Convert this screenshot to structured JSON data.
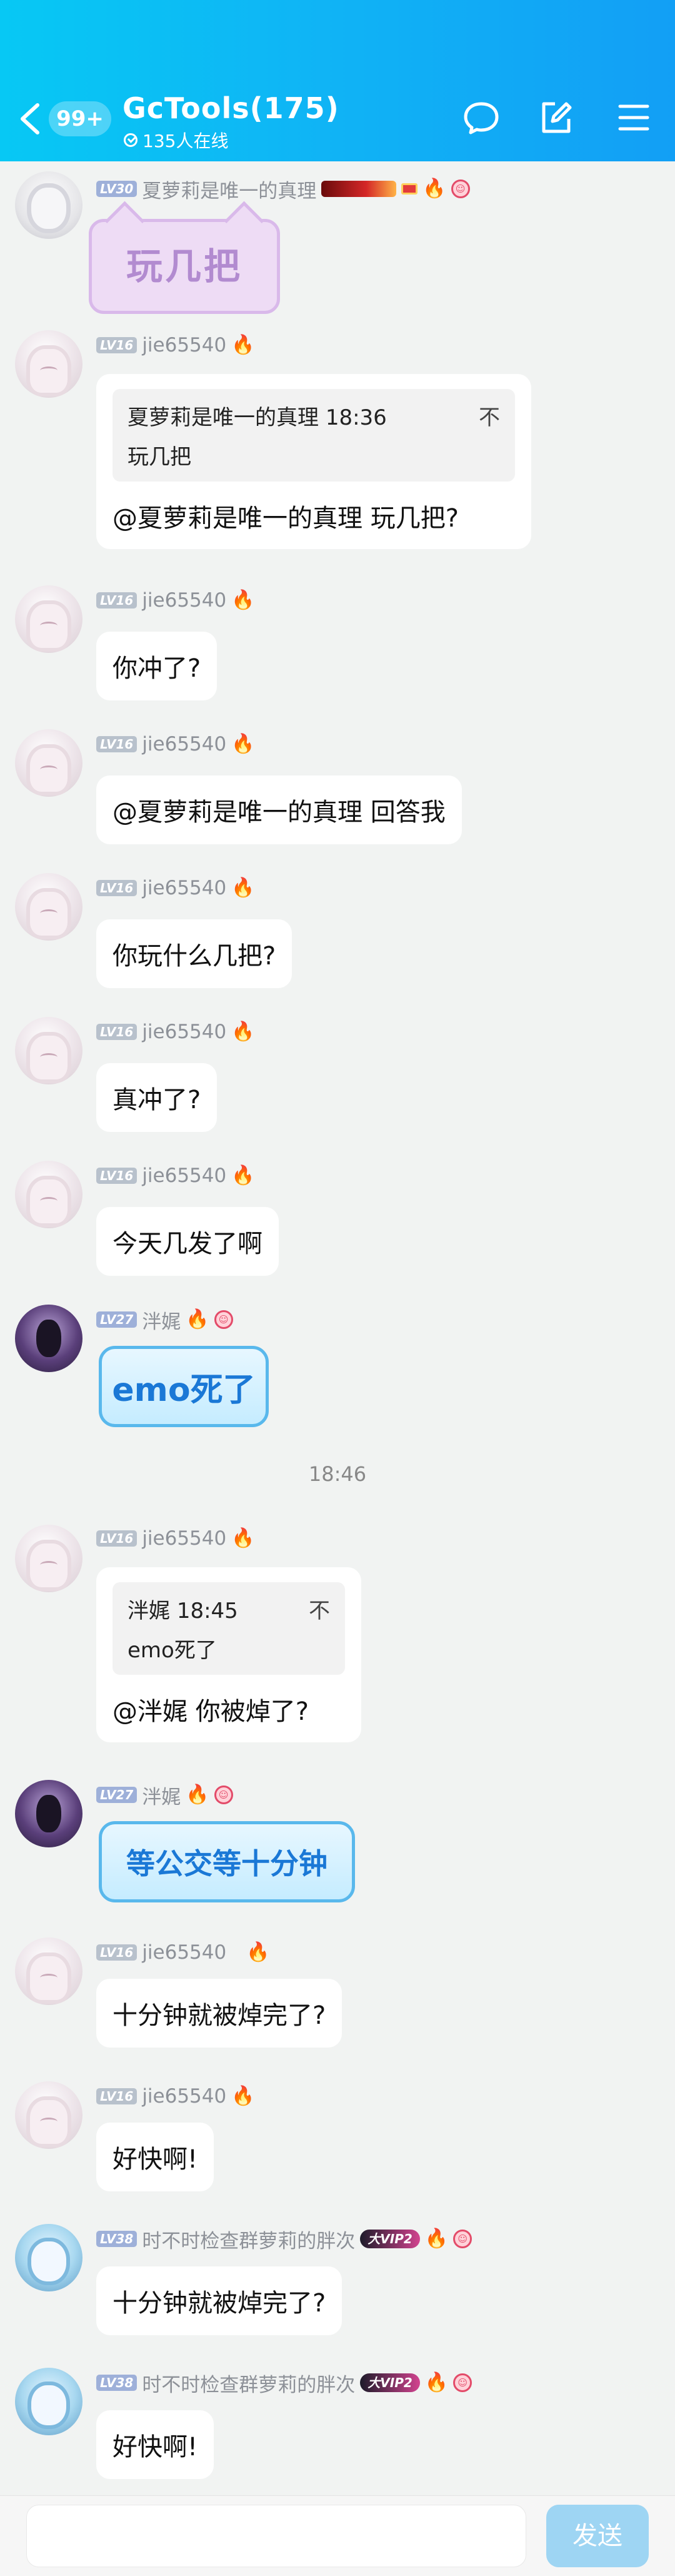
{
  "header": {
    "back_badge": "99+",
    "title": "GcTools(175)",
    "online": "135人在线"
  },
  "messages": [
    {
      "nick": "夏萝莉是唯一的真理",
      "level": "LV30",
      "sticker_text": "玩几把"
    },
    {
      "nick": "jie65540",
      "level": "LV16",
      "quote_author": "夏萝莉是唯一的真理",
      "quote_time": "18:36",
      "quote_text": "玩几把",
      "quote_close": "不",
      "text": "@夏萝莉是唯一的真理 玩几把?"
    },
    {
      "nick": "jie65540",
      "level": "LV16",
      "text": "你冲了?"
    },
    {
      "nick": "jie65540",
      "level": "LV16",
      "text": "@夏萝莉是唯一的真理 回答我"
    },
    {
      "nick": "jie65540",
      "level": "LV16",
      "text": "你玩什么几把?"
    },
    {
      "nick": "jie65540",
      "level": "LV16",
      "text": "真冲了?"
    },
    {
      "nick": "jie65540",
      "level": "LV16",
      "text": "今天几发了啊"
    },
    {
      "nick": "泮娓",
      "level": "LV27",
      "sticker_text": "emo死了"
    },
    {
      "nick": "jie65540",
      "level": "LV16",
      "quote_author": "泮娓",
      "quote_time": "18:45",
      "quote_text": "emo死了",
      "quote_close": "不",
      "text": "@泮娓 你被焯了?"
    },
    {
      "nick": "泮娓",
      "level": "LV27",
      "sticker_text": "等公交等十分钟"
    },
    {
      "nick": "jie65540",
      "level": "LV16",
      "text": "十分钟就被焯完了?"
    },
    {
      "nick": "jie65540",
      "level": "LV16",
      "text": "好快啊!"
    },
    {
      "nick": "时不时检查群萝莉的胖次",
      "level": "LV38",
      "vip": "大VIP2",
      "text": "十分钟就被焯完了?"
    },
    {
      "nick": "时不时检查群萝莉的胖次",
      "level": "LV38",
      "vip": "大VIP2",
      "text": "好快啊!"
    }
  ],
  "time_separator": "18:46",
  "input": {
    "placeholder": "",
    "send_label": "发送"
  },
  "colors": {
    "header_start": "#07c8f4",
    "header_end": "#129ff5",
    "send_button": "#9ed5f3",
    "background": "#f1f3f2"
  },
  "icons": [
    "back-icon",
    "chat-bubble-icon",
    "edit-icon",
    "menu-icon",
    "fire-icon"
  ]
}
